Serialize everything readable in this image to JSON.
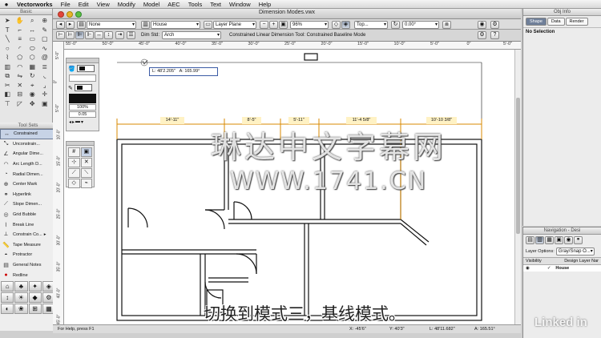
{
  "menubar": {
    "apple": "",
    "app": "Vectorworks",
    "items": [
      "File",
      "Edit",
      "View",
      "Modify",
      "Model",
      "AEC",
      "Tools",
      "Text",
      "Window",
      "Help"
    ]
  },
  "document": {
    "title": "Dimension Modes.vwx"
  },
  "viewbar": {
    "class": "None",
    "design_layer": "House",
    "layer_plane": "Layer Plane",
    "zoom": "96%",
    "view": "Top...",
    "rotation": "0.00°"
  },
  "modebar": {
    "dim_std_label": "Dim Std:",
    "dim_std": "Arch",
    "mode_text": "Constrained Linear Dimension Tool: Constrained Baseline Mode"
  },
  "palettes": {
    "basic": "Basic",
    "tool_sets": "Tool Sets"
  },
  "toolset_items": [
    "Constrained",
    "Unconstrain...",
    "Angular Dime...",
    "Arc Length D...",
    "Radial Dimen...",
    "Center Mark",
    "Hyperlink",
    "Slope Dimen...",
    "Grid Bubble",
    "Break Line",
    "Constrain Co...",
    "Tape Measure",
    "Protractor",
    "General Notes",
    "Redline"
  ],
  "attributes": {
    "line_weight": "100%",
    "thickness": "0.05"
  },
  "ruler_x": [
    "55'-0\"",
    "50'-0\"",
    "45'-0\"",
    "40'-0\"",
    "35'-0\"",
    "30'-0\"",
    "25'-0\"",
    "20'-0\"",
    "15'-0\"",
    "10'-0\"",
    "5'-0\"",
    "0\"",
    "5'-0\""
  ],
  "ruler_y": [
    "5'-0\"",
    "0\"",
    "5'-0\"",
    "10'-0\"",
    "15'-0\"",
    "20'-0\"",
    "25'-0\"",
    "30'-0\"",
    "35'-0\"",
    "40'-0\"",
    "45'-0\""
  ],
  "readout": {
    "length": "L:  48'2.205\"",
    "angle": "A:  165.99°"
  },
  "dimensions": [
    "14'-11\"",
    "8'-5\"",
    "5'-11\"",
    "11'-4 5/8\"",
    "10'-10 3/8\""
  ],
  "status": {
    "help": "For Help, press F1",
    "x": "X: -45'6\"",
    "y": "Y: 40'3\"",
    "l": "L: 48'11.682\"",
    "a": "A: 165.51°"
  },
  "obj_info": {
    "title": "Obj Info",
    "tabs": [
      "Shape",
      "Data",
      "Render"
    ],
    "selection": "No Selection"
  },
  "navigation": {
    "title": "Navigation - Desi",
    "layer_options_label": "Layer Options:",
    "layer_options": "Gray/Snap O...",
    "col_visibility": "Visibility",
    "col_layer": "Design Layer Nar",
    "layer_name": "House"
  },
  "watermark": {
    "line1": "琳达中文字幕网",
    "line2": "WWW.1741.CN",
    "brand": "Linked in"
  },
  "subtitle": "切换到模式三，基线模式。",
  "colors": {
    "dimension": "#d88a00",
    "selection_blue": "#c7d3e6"
  }
}
